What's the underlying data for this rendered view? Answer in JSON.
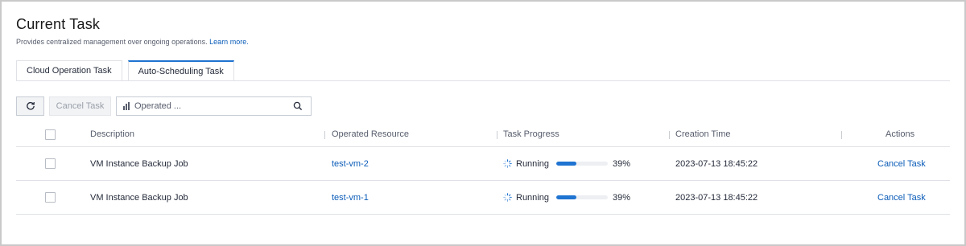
{
  "page": {
    "title": "Current Task",
    "subtitle": "Provides centralized management over ongoing operations.",
    "learn_more": "Learn more."
  },
  "tabs": [
    {
      "label": "Cloud Operation Task",
      "active": false
    },
    {
      "label": "Auto-Scheduling Task",
      "active": true
    }
  ],
  "toolbar": {
    "refresh_icon": "refresh-icon",
    "cancel_label": "Cancel Task",
    "search_placeholder": "Operated ...",
    "search_icon": "search-icon"
  },
  "table": {
    "columns": [
      "Description",
      "Operated Resource",
      "Task Progress",
      "Creation Time",
      "Actions"
    ],
    "rows": [
      {
        "description": "VM Instance Backup Job",
        "resource": "test-vm-2",
        "status": "Running",
        "progress": 39,
        "progress_text": "39%",
        "created": "2023-07-13 18:45:22",
        "action": "Cancel Task"
      },
      {
        "description": "VM Instance Backup Job",
        "resource": "test-vm-1",
        "status": "Running",
        "progress": 39,
        "progress_text": "39%",
        "created": "2023-07-13 18:45:22",
        "action": "Cancel Task"
      }
    ]
  },
  "colors": {
    "accent": "#1f73d1",
    "link": "#0b5cb8",
    "progress_track": "#edeff2"
  }
}
